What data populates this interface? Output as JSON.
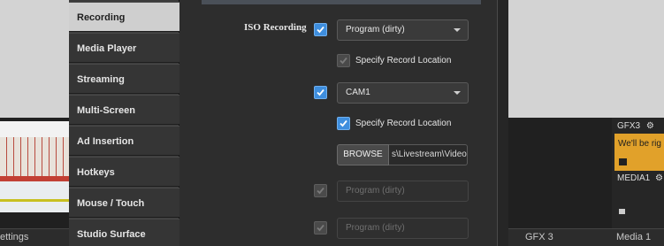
{
  "sidebar": {
    "items": [
      {
        "label": "Recording",
        "active": true
      },
      {
        "label": "Media Player"
      },
      {
        "label": "Streaming"
      },
      {
        "label": "Multi-Screen"
      },
      {
        "label": "Ad Insertion"
      },
      {
        "label": "Hotkeys"
      },
      {
        "label": "Mouse / Touch"
      },
      {
        "label": "Studio Surface"
      }
    ]
  },
  "recording": {
    "iso_label": "ISO Recording",
    "rows": [
      {
        "enabled": true,
        "source": "Program (dirty)",
        "specify_location": false,
        "specify_label": "Specify Record Location"
      },
      {
        "enabled": true,
        "source": "CAM1",
        "specify_location": true,
        "specify_label": "Specify Record Location",
        "browse_label": "BROWSE",
        "path": "s\\Livestream\\Videos\\"
      },
      {
        "enabled": false,
        "source": "Program (dirty)"
      },
      {
        "enabled": false,
        "source": "Program (dirty)"
      }
    ]
  },
  "background": {
    "gfx_label": "GFX3",
    "gfx_text": "We'll be rig",
    "media_label": "MEDIA1",
    "bottom_left": "ettings",
    "bottom_mid": "GFX 3",
    "bottom_right": "Media 1"
  },
  "colors": {
    "accent": "#3e8ede",
    "active_nav": "#cfcfcf",
    "gfx_card": "#e1a12a"
  },
  "icons": [
    "checkmark-icon",
    "chevron-down-icon",
    "gear-icon",
    "lock-icon"
  ]
}
